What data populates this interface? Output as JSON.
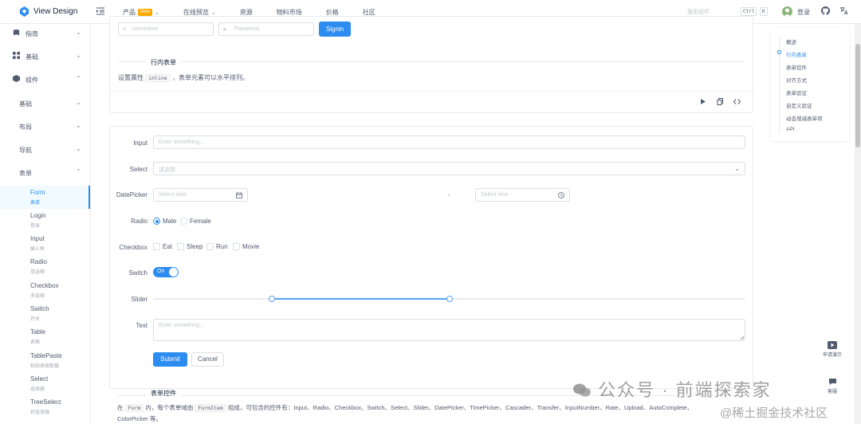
{
  "header": {
    "logo_text": "View Design",
    "nav": [
      {
        "label": "产品",
        "badge": "New",
        "has_caret": true
      },
      {
        "label": "在线预览",
        "has_caret": true
      },
      {
        "label": "资源"
      },
      {
        "label": "物料市场"
      },
      {
        "label": "价格"
      },
      {
        "label": "社区"
      }
    ],
    "search_placeholder": "搜索组件",
    "kbd_ctrl": "Ctrl",
    "kbd_k": "K",
    "login_label": "登录"
  },
  "sidebar": {
    "groups": [
      {
        "label": "指南",
        "icon": "book-icon",
        "expanded": false
      },
      {
        "label": "基础",
        "icon": "grid-icon",
        "expanded": false
      },
      {
        "label": "组件",
        "icon": "cube-icon",
        "expanded": true
      }
    ],
    "subgroups": [
      {
        "label": "基础",
        "expanded": false
      },
      {
        "label": "布局",
        "expanded": false
      },
      {
        "label": "导航",
        "expanded": false
      },
      {
        "label": "表单",
        "expanded": true
      }
    ],
    "items": [
      {
        "en": "Form",
        "zh": "表单",
        "active": true
      },
      {
        "en": "Login",
        "zh": "登录"
      },
      {
        "en": "Input",
        "zh": "输入框"
      },
      {
        "en": "Radio",
        "zh": "单选框"
      },
      {
        "en": "Checkbox",
        "zh": "多选框"
      },
      {
        "en": "Switch",
        "zh": "开关"
      },
      {
        "en": "Table",
        "zh": "表格"
      },
      {
        "en": "TablePaste",
        "zh": "粘贴表格数据"
      },
      {
        "en": "Select",
        "zh": "选择器"
      },
      {
        "en": "TreeSelect",
        "zh": "树选择器"
      }
    ]
  },
  "inline_demo": {
    "username_placeholder": "Username",
    "password_placeholder": "Password",
    "signin_label": "Signin",
    "section_title": "行内表单",
    "desc_prefix": "设置属性",
    "desc_code": "inline",
    "desc_suffix": "，表单元素可以水平排列。"
  },
  "form_demo": {
    "input_label": "Input",
    "input_placeholder": "Enter something...",
    "select_label": "Select",
    "select_placeholder": "请选择",
    "datepicker_label": "DatePicker",
    "date_placeholder": "Select date",
    "range_separator": "-",
    "time_placeholder": "Select time",
    "radio_label": "Radio",
    "radio_options": [
      {
        "label": "Male",
        "checked": true
      },
      {
        "label": "Female",
        "checked": false
      }
    ],
    "checkbox_label": "Checkbox",
    "checkbox_options": [
      "Eat",
      "Sleep",
      "Run",
      "Movie"
    ],
    "switch_label": "Switch",
    "switch_text": "On",
    "switch_on": true,
    "slider_label": "Slider",
    "slider_range": [
      20,
      50
    ],
    "text_label": "Text",
    "text_placeholder": "Enter something...",
    "submit_label": "Submit",
    "cancel_label": "Cancel"
  },
  "controls_section": {
    "title": "表单控件",
    "desc_1": "在",
    "code_form": "Form",
    "desc_2": "内，每个表单域由",
    "code_formitem": "FormItem",
    "desc_3": "组成，可包含的控件有：Input、Radio、Checkbox、Switch、Select、Slider、DatePicker、TimePicker、Cascader、Transfer、InputNumber、Rate、Upload、AutoComplete、",
    "desc_4": "ColorPicker 等。"
  },
  "anchor": {
    "items": [
      {
        "label": "概述"
      },
      {
        "label": "行内表单",
        "active": true
      },
      {
        "label": "表单控件"
      },
      {
        "label": "对齐方式"
      },
      {
        "label": "表单验证"
      },
      {
        "label": "自定义验证"
      },
      {
        "label": "动态增减表单项"
      },
      {
        "label": "API"
      }
    ]
  },
  "float": {
    "demo_label": "申请演示",
    "service_label": "客服"
  },
  "watermark": {
    "line1": "公众号 · 前端探索家",
    "line2": "@稀土掘金技术社区"
  },
  "colors": {
    "primary": "#2d8cf0",
    "border": "#dcdee2",
    "text": "#515a6e"
  }
}
